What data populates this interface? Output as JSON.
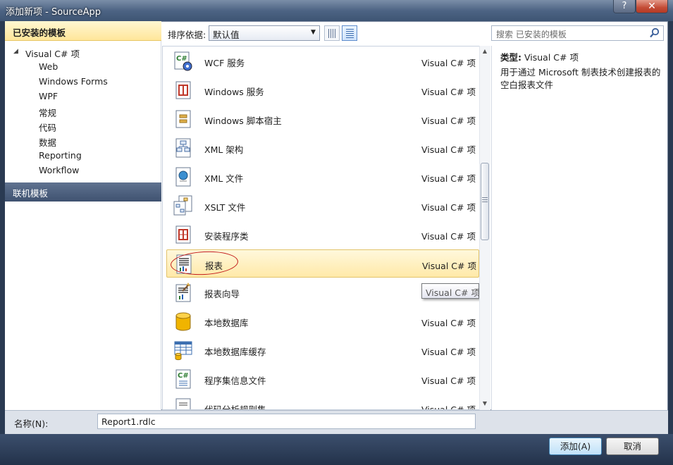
{
  "window": {
    "title": "添加新项 - SourceApp",
    "help_label": "?",
    "close_label": "✕"
  },
  "left_panel": {
    "installed_header": "已安装的模板",
    "tree_root": "Visual C# 项",
    "tree_children": [
      "Web",
      "Windows Forms",
      "WPF",
      "常规",
      "代码",
      "数据",
      "Reporting",
      "Workflow"
    ],
    "online_header": "联机模板"
  },
  "toolbar": {
    "sort_label": "排序依据:",
    "sort_value": "默认值"
  },
  "search": {
    "placeholder": "搜索 已安装的模板"
  },
  "items": [
    {
      "name": "WCF 服务",
      "type": "Visual C# 项",
      "icon": "wcf-service-icon"
    },
    {
      "name": "Windows 服务",
      "type": "Visual C# 项",
      "icon": "windows-service-icon"
    },
    {
      "name": "Windows 脚本宿主",
      "type": "Visual C# 项",
      "icon": "script-host-icon"
    },
    {
      "name": "XML 架构",
      "type": "Visual C# 项",
      "icon": "xml-schema-icon"
    },
    {
      "name": "XML 文件",
      "type": "Visual C# 项",
      "icon": "xml-file-icon"
    },
    {
      "name": "XSLT 文件",
      "type": "Visual C# 项",
      "icon": "xslt-file-icon"
    },
    {
      "name": "安装程序类",
      "type": "Visual C# 项",
      "icon": "installer-class-icon"
    },
    {
      "name": "报表",
      "type": "Visual C# 项",
      "icon": "report-icon"
    },
    {
      "name": "报表向导",
      "type": "Visual C# 项",
      "icon": "report-wizard-icon"
    },
    {
      "name": "本地数据库",
      "type": "Visual C# 项",
      "icon": "local-database-icon"
    },
    {
      "name": "本地数据库缓存",
      "type": "Visual C# 项",
      "icon": "database-cache-icon"
    },
    {
      "name": "程序集信息文件",
      "type": "Visual C# 项",
      "icon": "assembly-info-icon"
    },
    {
      "name": "代码分析规则集",
      "type": "Visual C# 项",
      "icon": "code-analysis-icon"
    }
  ],
  "tooltip": "Visual C# 项",
  "details": {
    "type_label": "类型:",
    "type_value": "Visual C# 项",
    "description": "用于通过 Microsoft 制表技术创建报表的空白报表文件"
  },
  "bottom": {
    "name_label": "名称(N):",
    "name_value": "Report1.rdlc",
    "add_label": "添加(A)",
    "cancel_label": "取消"
  },
  "colors": {
    "selection": "#ffe9a8",
    "annotation": "#c21a1a",
    "header": "#3f5270"
  }
}
